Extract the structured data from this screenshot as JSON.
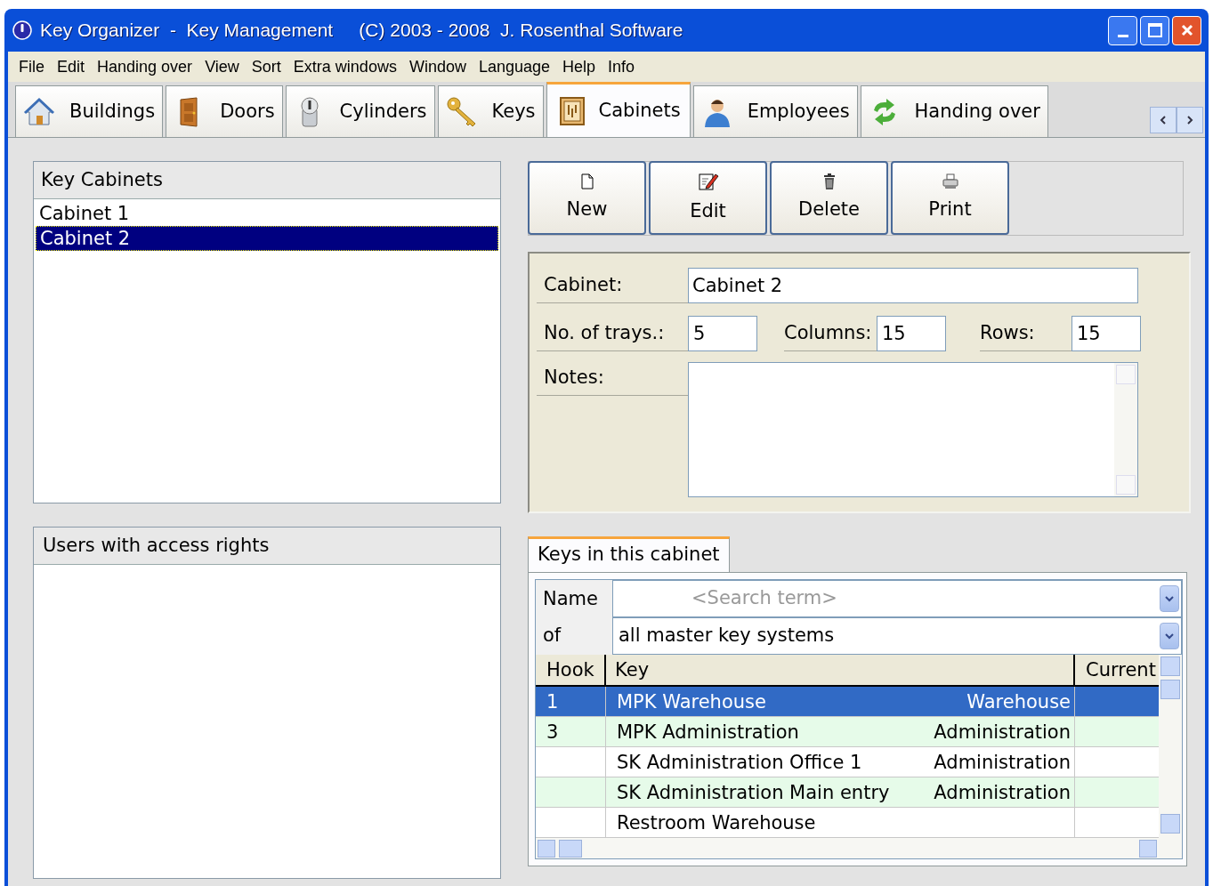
{
  "window": {
    "title": "Key Organizer  -  Key Management     (C) 2003 - 2008  J. Rosenthal Software"
  },
  "menu": [
    "File",
    "Edit",
    "Handing over",
    "View",
    "Sort",
    "Extra windows",
    "Window",
    "Language",
    "Help",
    "Info"
  ],
  "tabs": [
    {
      "label": "Buildings",
      "kind": "house",
      "selected": false
    },
    {
      "label": "Doors",
      "kind": "door",
      "selected": false
    },
    {
      "label": "Cylinders",
      "kind": "cylinder",
      "selected": false
    },
    {
      "label": "Keys",
      "kind": "key",
      "selected": false
    },
    {
      "label": "Cabinets",
      "kind": "cabinet",
      "selected": true
    },
    {
      "label": "Employees",
      "kind": "person",
      "selected": false
    },
    {
      "label": "Handing over",
      "kind": "arrows",
      "selected": false
    }
  ],
  "cabinet_list": {
    "title": "Key Cabinets",
    "items": [
      {
        "label": "Cabinet 1",
        "selected": false
      },
      {
        "label": "Cabinet 2",
        "selected": true
      }
    ]
  },
  "users_panel": {
    "title": "Users with access rights"
  },
  "toolbar": [
    {
      "label": "New",
      "kind": "page"
    },
    {
      "label": "Edit",
      "kind": "edit"
    },
    {
      "label": "Delete",
      "kind": "trash"
    },
    {
      "label": "Print",
      "kind": "printer"
    }
  ],
  "form": {
    "cabinet_label": "Cabinet:",
    "cabinet_value": "Cabinet 2",
    "trays_label": "No. of trays.:",
    "trays_value": "5",
    "columns_label": "Columns:",
    "columns_value": "15",
    "rows_label": "Rows:",
    "rows_value": "15",
    "notes_label": "Notes:"
  },
  "keys_panel": {
    "tab": "Keys in this cabinet",
    "name_label": "Name",
    "search_placeholder": "<Search term>",
    "of_label": "of",
    "system_value": "all master key systems",
    "columns": [
      "Hook",
      "Key",
      "Current"
    ],
    "rows": [
      {
        "hook": "1",
        "key": "MPK Warehouse",
        "area": "Warehouse",
        "selected": true
      },
      {
        "hook": "3",
        "key": "MPK Administration",
        "area": "Administration",
        "selected": false
      },
      {
        "hook": "",
        "key": "SK Administration Office 1",
        "area": "Administration",
        "selected": false
      },
      {
        "hook": "",
        "key": "SK Administration Main entry",
        "area": "Administration",
        "selected": false
      },
      {
        "hook": "",
        "key": "Restroom Warehouse",
        "area": "",
        "selected": false
      }
    ]
  }
}
